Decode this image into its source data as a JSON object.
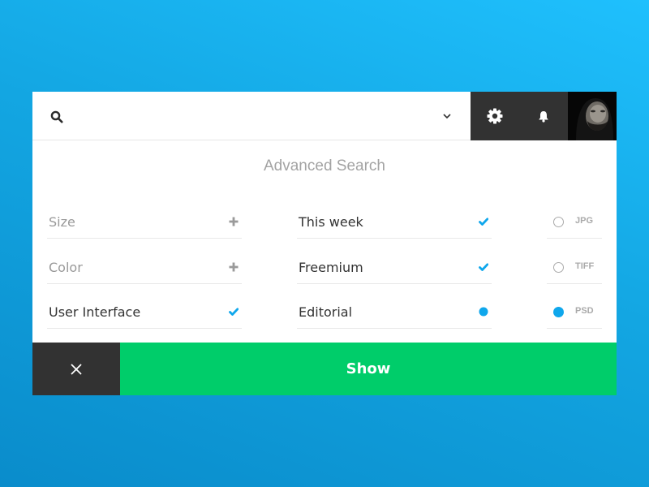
{
  "search": {
    "value": "",
    "placeholder": "",
    "icon": "search-icon",
    "dropdown_icon": "chevron-down-icon"
  },
  "toolbar": {
    "settings_icon": "gear-icon",
    "notifications_icon": "bell-icon",
    "avatar_alt": "User avatar"
  },
  "title": "Advanced Search",
  "filters": {
    "column1": [
      {
        "label": "Size",
        "state": "add",
        "icon": "plus-icon"
      },
      {
        "label": "Color",
        "state": "add",
        "icon": "plus-icon"
      },
      {
        "label": "User Interface",
        "state": "checked",
        "icon": "check-icon"
      }
    ],
    "column2": [
      {
        "label": "This week",
        "state": "checked",
        "icon": "check-icon"
      },
      {
        "label": "Freemium",
        "state": "checked",
        "icon": "check-icon"
      },
      {
        "label": "Editorial",
        "state": "dot",
        "icon": "dot-icon"
      }
    ]
  },
  "formats": [
    {
      "label": "JPG",
      "selected": false
    },
    {
      "label": "TIFF",
      "selected": false
    },
    {
      "label": "PSD",
      "selected": true
    }
  ],
  "footer": {
    "close_icon": "close-icon",
    "show_label": "Show"
  },
  "colors": {
    "accent": "#0fa7ec",
    "primary_button": "#00cd6a",
    "dark": "#323232"
  }
}
